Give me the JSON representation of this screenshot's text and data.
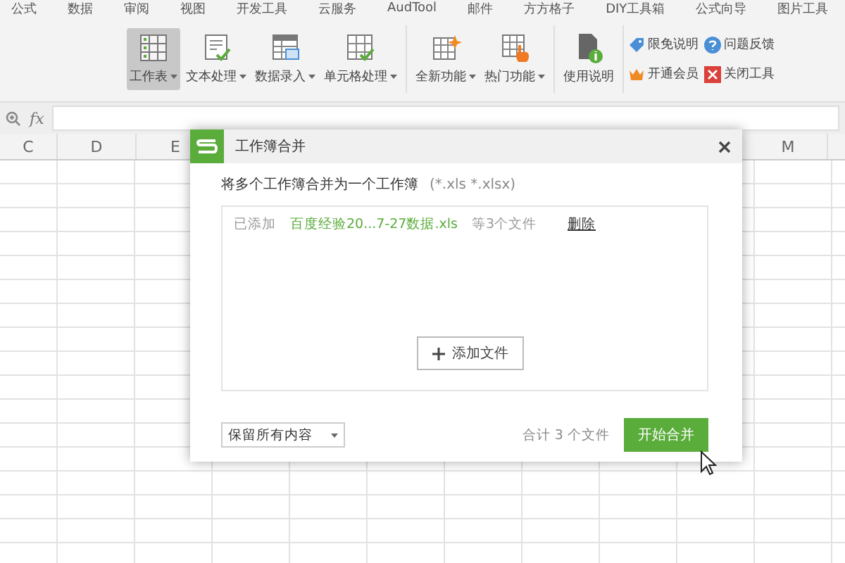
{
  "menu_tabs": [
    "公式",
    "数据",
    "审阅",
    "视图",
    "开发工具",
    "云服务",
    "AudTool",
    "邮件",
    "方方格子",
    "DIY工具箱",
    "公式向导",
    "图片工具"
  ],
  "ribbon": {
    "groups": [
      {
        "buttons": [
          {
            "label": "工作表",
            "dropdown": true,
            "selected": true
          },
          {
            "label": "文本处理",
            "dropdown": true,
            "selected": false
          },
          {
            "label": "数据录入",
            "dropdown": true,
            "selected": false
          },
          {
            "label": "单元格处理",
            "dropdown": true,
            "selected": false
          }
        ]
      },
      {
        "buttons": [
          {
            "label": "全新功能",
            "dropdown": true,
            "selected": false
          },
          {
            "label": "热门功能",
            "dropdown": true,
            "selected": false
          }
        ]
      },
      {
        "buttons": [
          {
            "label": "使用说明",
            "dropdown": false,
            "selected": false
          }
        ]
      }
    ],
    "small_buttons": [
      "限免说明",
      "问题反馈",
      "开通会员",
      "关闭工具"
    ]
  },
  "formula_bar": {
    "fx": "fx"
  },
  "columns": [
    "C",
    "D",
    "E",
    "M"
  ],
  "dialog": {
    "title": "工作簿合并",
    "instruction": "将多个工作簿合并为一个工作簿",
    "formats": "(*.xls *.xlsx)",
    "files": [
      {
        "status": "已添加",
        "name": "百度经验20...7-27数据.xls",
        "count": "等3个文件",
        "action": "删除"
      }
    ],
    "add_button": "添加文件",
    "mode": "保留所有内容",
    "total": "合计 3 个文件",
    "start_button": "开始合并"
  }
}
